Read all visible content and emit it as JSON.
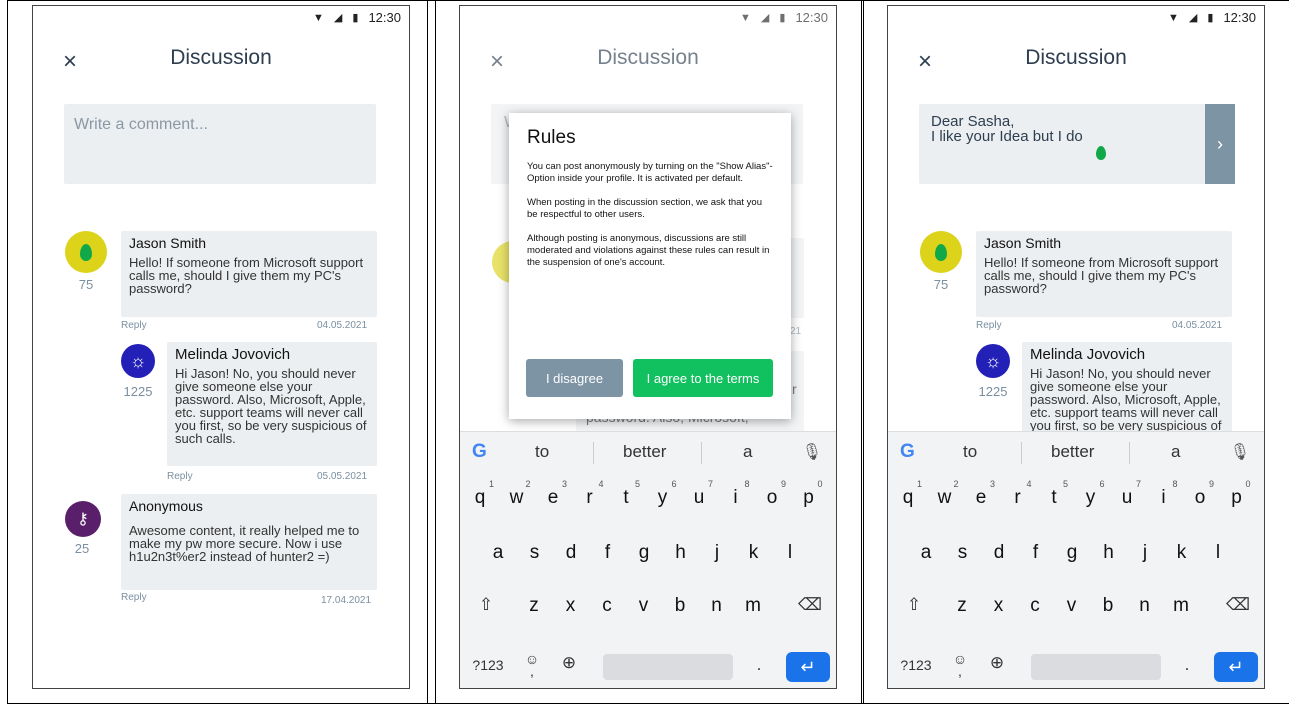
{
  "status": {
    "time": "12:30",
    "wifi_icon": "wifi-icon",
    "signal_icon": "signal-icon",
    "battery_icon": "battery-icon"
  },
  "header": {
    "title": "Discussion",
    "close": "×"
  },
  "composer": {
    "placeholder": "Write a comment...",
    "typed_line1": "Dear Sasha,",
    "typed_line2": "I like your Idea but I do",
    "send": "›"
  },
  "comments": [
    {
      "name": "Jason Smith",
      "text": "Hello! If someone from Microsoft support calls me, should I give them my PC's password?",
      "score": "75",
      "reply": "Reply",
      "date": "04.05.2021",
      "avatar": "drop-icon"
    },
    {
      "name": "Melinda Jovovich",
      "text": "Hi Jason! No, you should never give someone else your password. Also, Microsoft, Apple, etc. support teams will never call you first, so be very suspicious of such calls.",
      "score": "1225",
      "reply": "Reply",
      "date": "05.05.2021",
      "avatar": "bug-icon"
    },
    {
      "name": "Anonymous",
      "text": "Awesome content, it really helped me to make my pw more secure. Now i use h1u2n3t%er2 instead of hunter2 =)",
      "score": "25",
      "reply": "Reply",
      "date": "17.04.2021",
      "avatar": "key-icon"
    }
  ],
  "dialog": {
    "title": "Rules",
    "p1": "You can post anonymously by turning on the \"Show Alias\"-Option inside your profile. It is activated per default.",
    "p2": "When posting in the discussion section, we ask that you be respectful to other users.",
    "p3": "Although posting is anonymous, discussions are still moderated and violations against these rules can result in the suspension of one's account.",
    "disagree": "I disagree",
    "agree": "I agree to the terms"
  },
  "dialog_behind": {
    "w": "W",
    "m": "m",
    "date_frag": "21",
    "r": "r",
    "text_frag": "password. Also, Microsoft,"
  },
  "keyboard": {
    "suggestions": [
      "to",
      "better",
      "a"
    ],
    "row1": [
      "q",
      "w",
      "e",
      "r",
      "t",
      "y",
      "u",
      "i",
      "o",
      "p"
    ],
    "row1_nums": [
      "1",
      "2",
      "3",
      "4",
      "5",
      "6",
      "7",
      "8",
      "9",
      "0"
    ],
    "row2": [
      "a",
      "s",
      "d",
      "f",
      "g",
      "h",
      "j",
      "k",
      "l"
    ],
    "row3": [
      "z",
      "x",
      "c",
      "v",
      "b",
      "n",
      "m"
    ],
    "shift": "⇧",
    "backspace": "⌫",
    "numbers": "?123",
    "emoji": "☺",
    "comma": ",",
    "globe": "⊕",
    "period": ".",
    "enter": "↵",
    "google": "G",
    "mic": "🎙"
  }
}
